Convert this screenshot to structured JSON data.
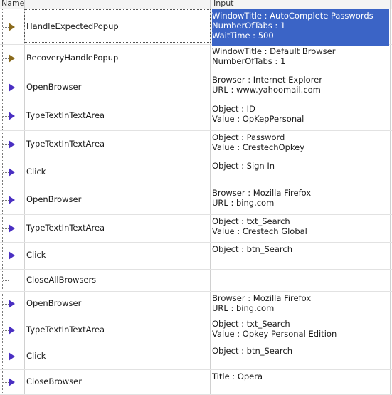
{
  "columns": {
    "name": "Name",
    "input": "Input"
  },
  "rows": [
    {
      "name": "HandleExpectedPopup",
      "icon": "brown-arrow-icon",
      "input": [
        "WindowTitle : AutoComplete Passwords",
        "NumberOfTabs : 1",
        "WaitTime : 500"
      ]
    },
    {
      "name": "RecoveryHandlePopup",
      "icon": "brown-arrow-icon",
      "input": [
        "WindowTitle : Default Browser",
        "NumberOfTabs : 1"
      ]
    },
    {
      "name": "OpenBrowser",
      "icon": "blue-arrow-icon",
      "input": [
        "Browser : Internet Explorer",
        "URL : www.yahoomail.com"
      ]
    },
    {
      "name": "TypeTextInTextArea",
      "icon": "blue-arrow-icon",
      "input": [
        "Object : ID",
        "Value : OpKepPersonal"
      ]
    },
    {
      "name": "TypeTextInTextArea",
      "icon": "blue-arrow-icon",
      "input": [
        "Object : Password",
        "Value : CrestechOpkey"
      ]
    },
    {
      "name": "Click",
      "icon": "blue-arrow-icon",
      "input": [
        "Object : Sign In"
      ]
    },
    {
      "name": "OpenBrowser",
      "icon": "blue-arrow-icon",
      "input": [
        "Browser : Mozilla Firefox",
        "URL : bing.com"
      ]
    },
    {
      "name": "TypeTextInTextArea",
      "icon": "blue-arrow-icon",
      "input": [
        "Object : txt_Search",
        "Value : Crestech Global"
      ]
    },
    {
      "name": "Click",
      "icon": "blue-arrow-icon",
      "input": [
        "Object : btn_Search"
      ]
    },
    {
      "name": "CloseAllBrowsers",
      "icon": "none",
      "input": []
    },
    {
      "name": "OpenBrowser",
      "icon": "blue-arrow-icon",
      "input": [
        "Browser : Mozilla Firefox",
        "URL : bing.com"
      ]
    },
    {
      "name": "TypeTextInTextArea",
      "icon": "blue-arrow-icon",
      "input": [
        "Object : txt_Search",
        "Value : Opkey Personal Edition"
      ]
    },
    {
      "name": "Click",
      "icon": "blue-arrow-icon",
      "input": [
        "Object : btn_Search"
      ]
    },
    {
      "name": "CloseBrowser",
      "icon": "blue-arrow-icon",
      "input": [
        "Title : Opera"
      ]
    }
  ],
  "colors": {
    "selection": "#3b64c6",
    "arrow_blue": "#4a2fc2",
    "arrow_brown": "#8a6a1c"
  }
}
